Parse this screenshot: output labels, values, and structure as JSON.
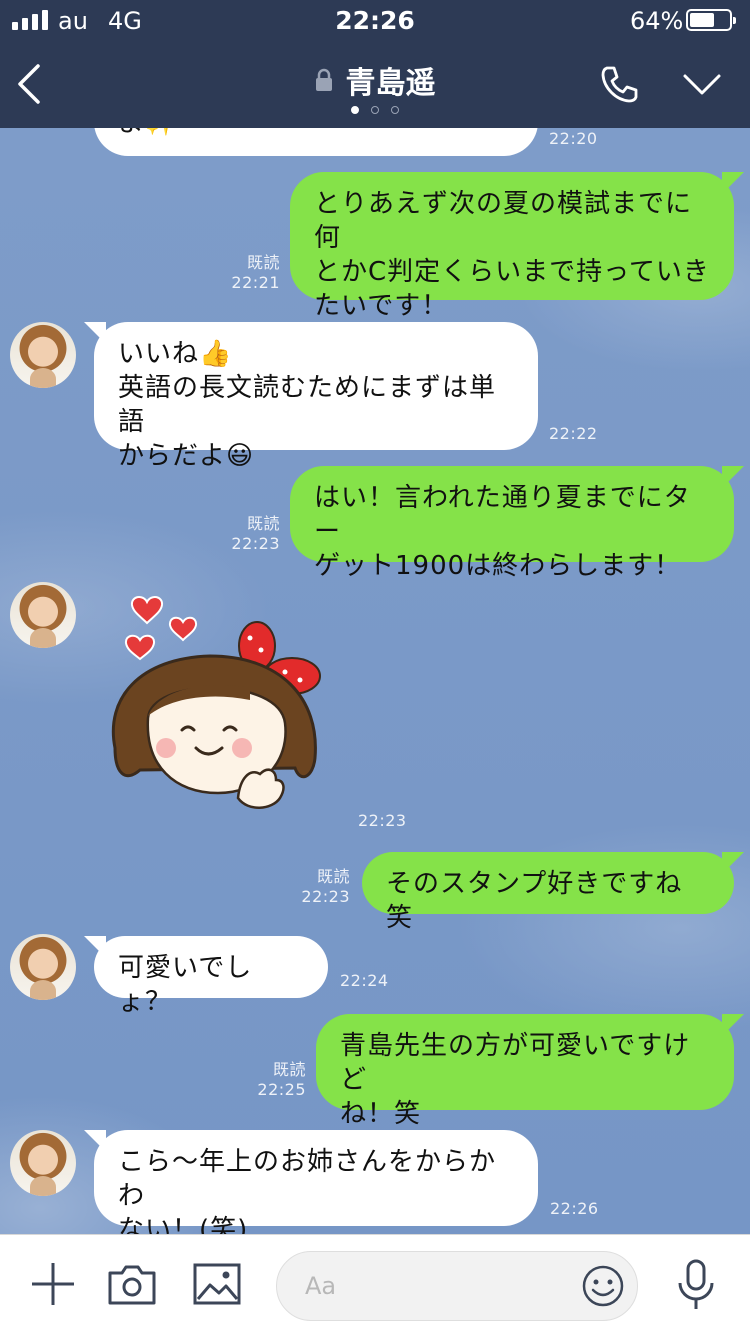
{
  "status_bar": {
    "carrier": "au",
    "network": "4G",
    "time": "22:26",
    "battery_percent": "64%",
    "battery_level": 0.64
  },
  "header": {
    "title": "青島遥",
    "page_dots": 3,
    "active_dot": 0
  },
  "messages": [
    {
      "side": "in",
      "text": "よ✨",
      "time": "22:20"
    },
    {
      "side": "out",
      "lines": [
        "とりあえず次の夏の模試までに何",
        "とかC判定くらいまで持っていき",
        "たいです！"
      ],
      "read": "既読",
      "time": "22:21"
    },
    {
      "side": "in",
      "lines": [
        "いいね👍",
        "英語の長文読むためにまずは単語",
        "からだよ😃"
      ],
      "time": "22:22"
    },
    {
      "side": "out",
      "lines": [
        "はい！言われた通り夏までにター",
        "ゲット1900は終わらします！"
      ],
      "read": "既読",
      "time": "22:23"
    },
    {
      "side": "in",
      "sticker": "girl-sticker",
      "time": "22:23"
    },
    {
      "side": "out",
      "lines": [
        "そのスタンプ好きですね 笑"
      ],
      "read": "既読",
      "time": "22:23"
    },
    {
      "side": "in",
      "lines": [
        "可愛いでしょ？"
      ],
      "time": "22:24"
    },
    {
      "side": "out",
      "lines": [
        "青島先生の方が可愛いですけど",
        "ね！笑"
      ],
      "read": "既読",
      "time": "22:25"
    },
    {
      "side": "in",
      "lines": [
        "こら〜年上のお姉さんをからかわ",
        "ない！(笑)"
      ],
      "time": "22:26"
    }
  ],
  "input": {
    "placeholder": "Aa"
  },
  "colors": {
    "header_bg": "#2d3a55",
    "outgoing_bubble": "#85e249",
    "incoming_bubble": "#ffffff",
    "chat_bg": "#7d9bc7"
  }
}
